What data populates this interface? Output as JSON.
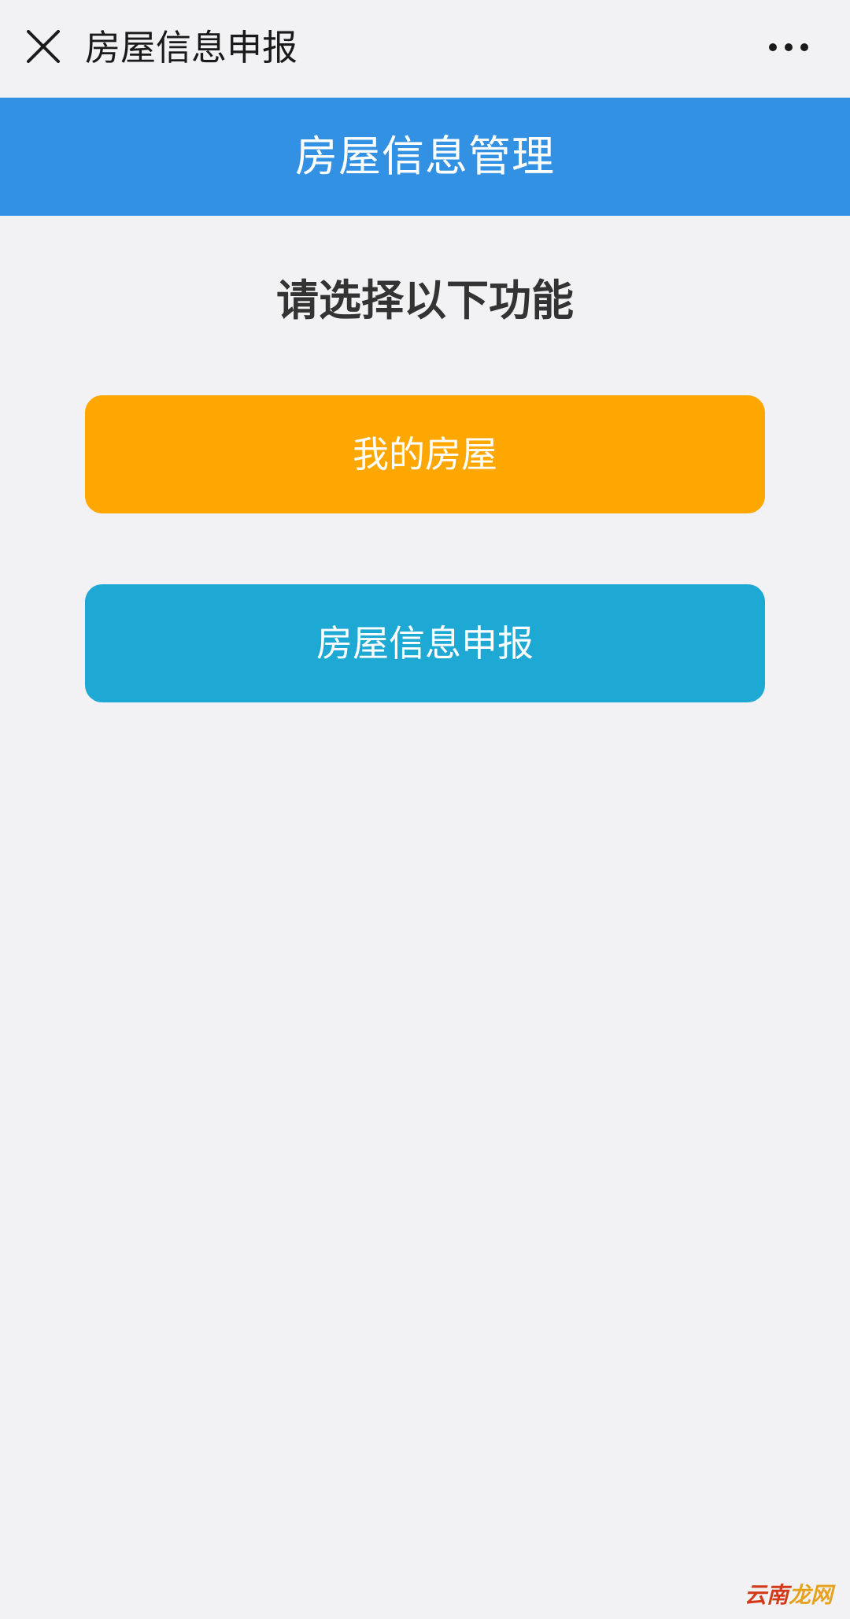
{
  "topbar": {
    "title": "房屋信息申报",
    "close_icon": "close-icon",
    "more_icon": "more-dots-icon"
  },
  "header": {
    "title": "房屋信息管理",
    "color": "#3391e3"
  },
  "main": {
    "prompt": "请选择以下功能",
    "buttons": [
      {
        "label": "我的房屋",
        "color": "#fea700"
      },
      {
        "label": "房屋信息申报",
        "color": "#1ea8d4"
      }
    ]
  },
  "watermark": {
    "part1": "云南",
    "part2": "龙网"
  }
}
